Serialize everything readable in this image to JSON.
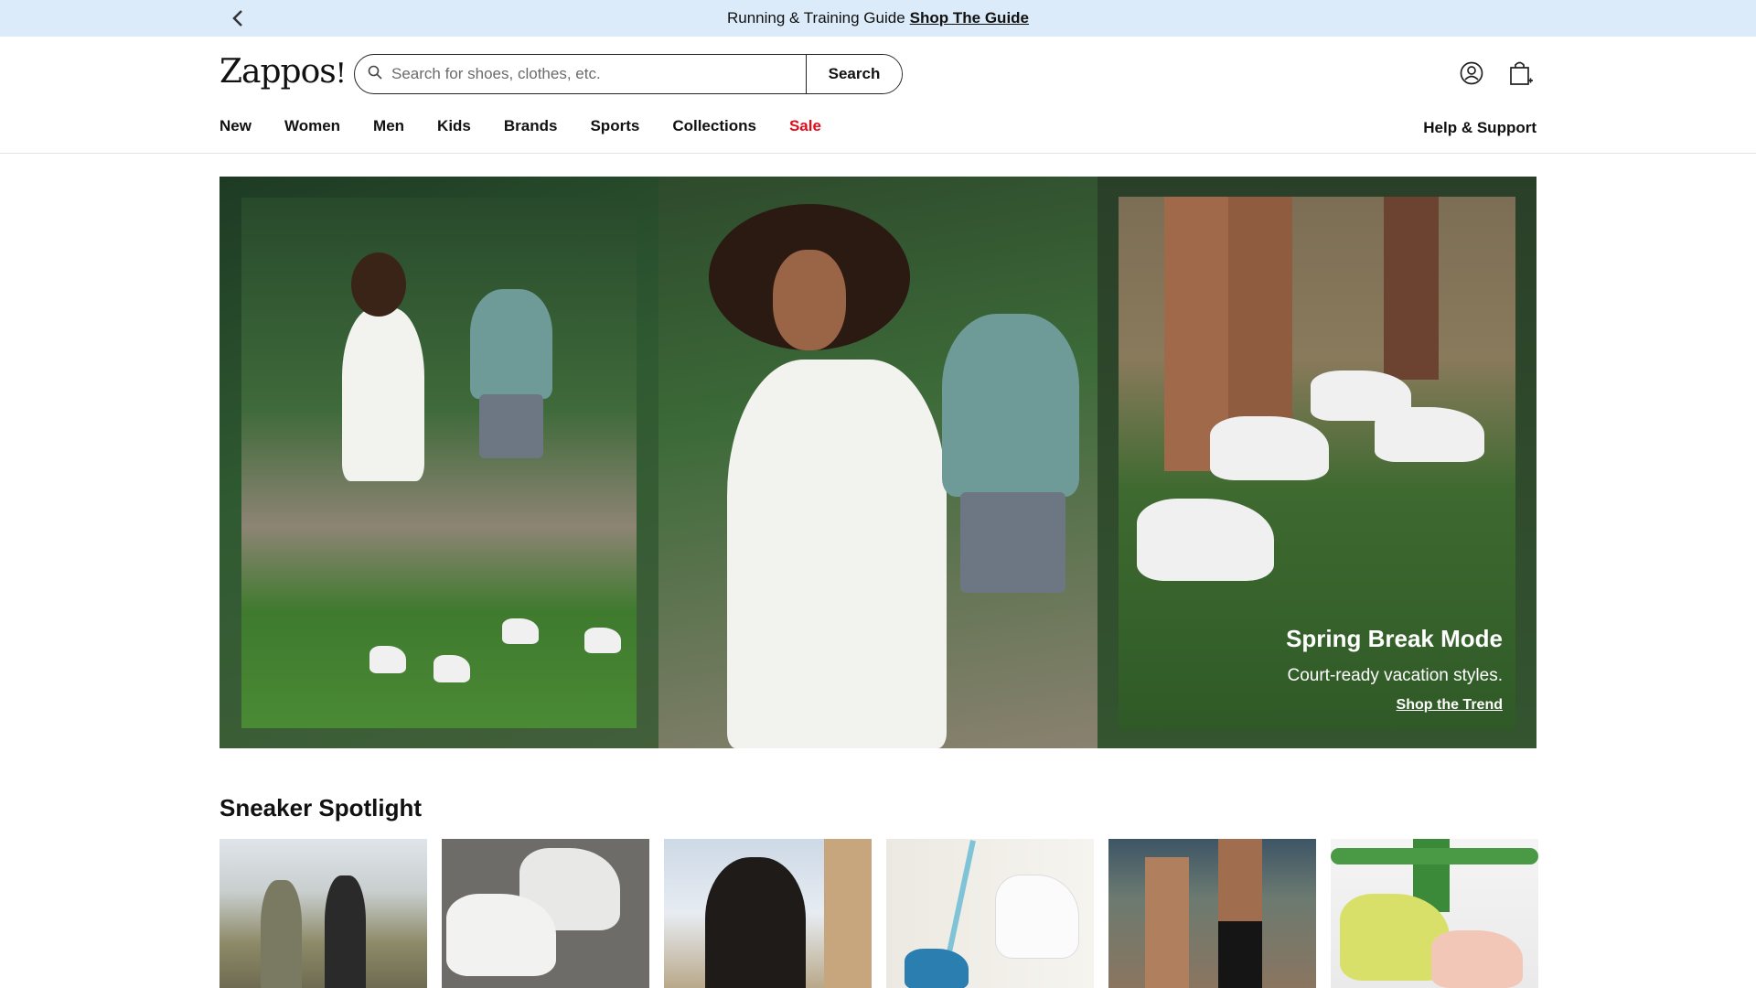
{
  "promo": {
    "text": "Running & Training Guide",
    "cta": "Shop The Guide"
  },
  "header": {
    "logo": "Zappos",
    "search_placeholder": "Search for shoes, clothes, etc.",
    "search_button": "Search",
    "icons": [
      "account-icon",
      "cart-icon"
    ]
  },
  "nav": {
    "items": [
      "New",
      "Women",
      "Men",
      "Kids",
      "Brands",
      "Sports",
      "Collections",
      "Sale"
    ],
    "help": "Help & Support"
  },
  "hero": {
    "title": "Spring Break Mode",
    "subtitle": "Court-ready vacation styles.",
    "cta": "Shop the Trend"
  },
  "spotlight": {
    "title": "Sneaker Spotlight",
    "tile_count": 6
  },
  "colors": {
    "promo_bg": "#dcebf9",
    "sale": "#e00c1a",
    "text": "#111111"
  }
}
